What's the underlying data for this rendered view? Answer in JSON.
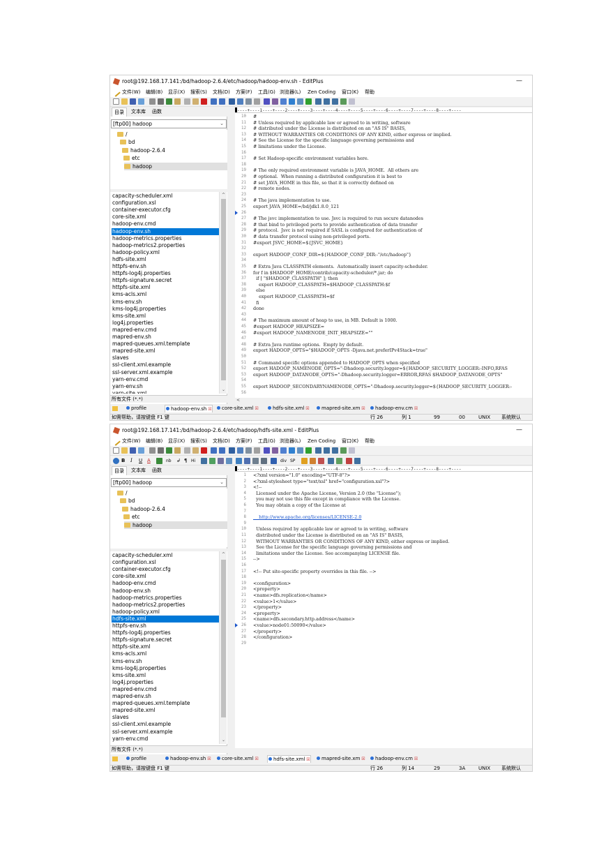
{
  "menu_items": [
    "文件(W)",
    "编辑(B)",
    "显示(X)",
    "搜索(S)",
    "文档(D)",
    "方案(F)",
    "工具(G)",
    "浏览器(L)",
    "Zen Coding",
    "窗口(K)",
    "帮助"
  ],
  "left_tabs": [
    "目录",
    "文本库",
    "函数"
  ],
  "drive": "[ftp00] hadoop",
  "tree": [
    "/",
    "bd",
    "hadoop-2.6.4",
    "etc",
    "hadoop"
  ],
  "filter": "所有文件 (*.*)",
  "status_help": "如需帮助，请按键盘 F1 键",
  "ruler": "----+----1----+----2----+----3----+----4----+----5----+----6----+----7----+----8----+----",
  "format_toolbar": [
    "B",
    "I",
    "U",
    "A",
    "nb",
    "↲",
    "¶",
    "Hi",
    "div",
    "SP"
  ],
  "window1": {
    "title": "root@192.168.17.141:/bd/hadoop-2.6.4/etc/hadoop/hadoop-env.sh - EditPlus",
    "files": [
      "capacity-scheduler.xml",
      "configuration.xsl",
      "container-executor.cfg",
      "core-site.xml",
      "hadoop-env.cmd",
      "hadoop-env.sh",
      "hadoop-metrics.properties",
      "hadoop-metrics2.properties",
      "hadoop-policy.xml",
      "hdfs-site.xml",
      "httpfs-env.sh",
      "httpfs-log4j.properties",
      "httpfs-signature.secret",
      "httpfs-site.xml",
      "kms-acls.xml",
      "kms-env.sh",
      "kms-log4j.properties",
      "kms-site.xml",
      "log4j.properties",
      "mapred-env.cmd",
      "mapred-env.sh",
      "mapred-queues.xml.template",
      "mapred-site.xml",
      "slaves",
      "ssl-client.xml.example",
      "ssl-server.xml.example",
      "yarn-env.cmd",
      "yarn-env.sh",
      "yarn-site.xml"
    ],
    "lines": [
      [
        "10",
        "#"
      ],
      [
        "11",
        "# Unless required by applicable law or agreed to in writing, software"
      ],
      [
        "12",
        "# distributed under the License is distributed on an \"AS IS\" BASIS,"
      ],
      [
        "13",
        "# WITHOUT WARRANTIES OR CONDITIONS OF ANY KIND, either express or implied."
      ],
      [
        "14",
        "# See the License for the specific language governing permissions and"
      ],
      [
        "15",
        "# limitations under the License."
      ],
      [
        "16",
        ""
      ],
      [
        "17",
        "# Set Hadoop-specific environment variables here."
      ],
      [
        "18",
        ""
      ],
      [
        "19",
        "# The only required environment variable is JAVA_HOME.  All others are"
      ],
      [
        "20",
        "# optional.  When running a distributed configuration it is best to"
      ],
      [
        "21",
        "# set JAVA_HOME in this file, so that it is correctly defined on"
      ],
      [
        "22",
        "# remote nodes."
      ],
      [
        "23",
        ""
      ],
      [
        "24",
        "# The java implementation to use."
      ],
      [
        "25",
        "export JAVA_HOME=/bd/jdk1.8.0_121"
      ],
      [
        "26",
        ""
      ],
      [
        "27",
        "# The jsvc implementation to use. Jsvc is required to run secure datanodes"
      ],
      [
        "28",
        "# that bind to privileged ports to provide authentication of data transfer"
      ],
      [
        "29",
        "# protocol.  Jsvc is not required if SASL is configured for authentication of"
      ],
      [
        "30",
        "# data transfer protocol using non-privileged ports."
      ],
      [
        "31",
        "#export JSVC_HOME=${JSVC_HOME}"
      ],
      [
        "32",
        ""
      ],
      [
        "33",
        "export HADOOP_CONF_DIR=${HADOOP_CONF_DIR:-\"/etc/hadoop\"}"
      ],
      [
        "34",
        ""
      ],
      [
        "35",
        "# Extra Java CLASSPATH elements.  Automatically insert capacity-scheduler."
      ],
      [
        "36",
        "for f in $HADOOP_HOME/contrib/capacity-scheduler/*.jar; do"
      ],
      [
        "37",
        "  if [ \"$HADOOP_CLASSPATH\" ]; then"
      ],
      [
        "38",
        "    export HADOOP_CLASSPATH=$HADOOP_CLASSPATH:$f"
      ],
      [
        "39",
        "  else"
      ],
      [
        "40",
        "    export HADOOP_CLASSPATH=$f"
      ],
      [
        "41",
        "  fi"
      ],
      [
        "42",
        "done"
      ],
      [
        "43",
        ""
      ],
      [
        "44",
        "# The maximum amount of heap to use, in MB. Default is 1000."
      ],
      [
        "45",
        "#export HADOOP_HEAPSIZE="
      ],
      [
        "46",
        "#export HADOOP_NAMENODE_INIT_HEAPSIZE=\"\""
      ],
      [
        "47",
        ""
      ],
      [
        "48",
        "# Extra Java runtime options.  Empty by default."
      ],
      [
        "49",
        "export HADOOP_OPTS=\"$HADOOP_OPTS -Djava.net.preferIPv4Stack=true\""
      ],
      [
        "50",
        ""
      ],
      [
        "51",
        "# Command specific options appended to HADOOP_OPTS when specified"
      ],
      [
        "52",
        "export HADOOP_NAMENODE_OPTS=\"-Dhadoop.security.logger=${HADOOP_SECURITY_LOGGER:-INFO,RFAS"
      ],
      [
        "53",
        "export HADOOP_DATANODE_OPTS=\"-Dhadoop.security.logger=ERROR,RFAS $HADOOP_DATANODE_OPTS\""
      ],
      [
        "54",
        ""
      ],
      [
        "55",
        "export HADOOP_SECONDARYNAMENODE_OPTS=\"-Dhadoop.security.logger=${HADOOP_SECURITY_LOGGER:-"
      ],
      [
        "56",
        ""
      ]
    ],
    "doc_tabs": [
      "profile",
      "hadoop-env.sh",
      "core-site.xml",
      "hdfs-site.xml",
      "mapred-site.xm",
      "hadoop-env.cm"
    ],
    "status": {
      "row": "行 26",
      "col": "列 1",
      "count": "99",
      "code": "00",
      "mode": "UNIX",
      "enc": "系统默认"
    }
  },
  "window2": {
    "title": "root@192.168.17.141:/bd/hadoop-2.6.4/etc/hadoop/hdfs-site.xml - EditPlus",
    "files": [
      "capacity-scheduler.xml",
      "configuration.xsl",
      "container-executor.cfg",
      "core-site.xml",
      "hadoop-env.cmd",
      "hadoop-env.sh",
      "hadoop-metrics.properties",
      "hadoop-metrics2.properties",
      "hadoop-policy.xml",
      "hdfs-site.xml",
      "httpfs-env.sh",
      "httpfs-log4j.properties",
      "httpfs-signature.secret",
      "httpfs-site.xml",
      "kms-acls.xml",
      "kms-env.sh",
      "kms-log4j.properties",
      "kms-site.xml",
      "log4j.properties",
      "mapred-env.cmd",
      "mapred-env.sh",
      "mapred-queues.xml.template",
      "mapred-site.xml",
      "slaves",
      "ssl-client.xml.example",
      "ssl-server.xml.example",
      "yarn-env.cmd"
    ],
    "lines": [
      [
        "1",
        "<?xml version=\"1.0\" encoding=\"UTF-8\"?>"
      ],
      [
        "2",
        "<?xml-stylesheet type=\"text/xsl\" href=\"configuration.xsl\"?>"
      ],
      [
        "3",
        "<!--"
      ],
      [
        "4",
        "  Licensed under the Apache License, Version 2.0 (the \"License\");"
      ],
      [
        "5",
        "  you may not use this file except in compliance with the License."
      ],
      [
        "6",
        "  You may obtain a copy of the License at"
      ],
      [
        "7",
        ""
      ],
      [
        "8",
        "    http://www.apache.org/licenses/LICENSE-2.0"
      ],
      [
        "9",
        ""
      ],
      [
        "10",
        "  Unless required by applicable law or agreed to in writing, software"
      ],
      [
        "11",
        "  distributed under the License is distributed on an \"AS IS\" BASIS,"
      ],
      [
        "12",
        "  WITHOUT WARRANTIES OR CONDITIONS OF ANY KIND, either express or implied."
      ],
      [
        "13",
        "  See the License for the specific language governing permissions and"
      ],
      [
        "14",
        "  limitations under the License. See accompanying LICENSE file."
      ],
      [
        "15",
        "-->"
      ],
      [
        "16",
        ""
      ],
      [
        "17",
        "<!-- Put site-specific property overrides in this file. -->"
      ],
      [
        "18",
        ""
      ],
      [
        "19",
        "<configuration>"
      ],
      [
        "20",
        "<property>"
      ],
      [
        "21",
        "<name>dfs.replication</name>"
      ],
      [
        "22",
        "<value>1</value>"
      ],
      [
        "23",
        "</property>"
      ],
      [
        "24",
        "<property>"
      ],
      [
        "25",
        "<name>dfs.secondary.http.address</name>"
      ],
      [
        "26",
        "<value>node01:50090</value>"
      ],
      [
        "27",
        "</property>"
      ],
      [
        "28",
        "</configuration>"
      ],
      [
        "29",
        ""
      ]
    ],
    "doc_tabs": [
      "profile",
      "hadoop-env.sh",
      "core-site.xml",
      "hdfs-site.xml",
      "mapred-site.xm",
      "hadoop-env.cm"
    ],
    "status": {
      "row": "行 26",
      "col": "列 14",
      "count": "29",
      "code": "3A",
      "mode": "UNIX",
      "enc": "系统默认"
    }
  }
}
